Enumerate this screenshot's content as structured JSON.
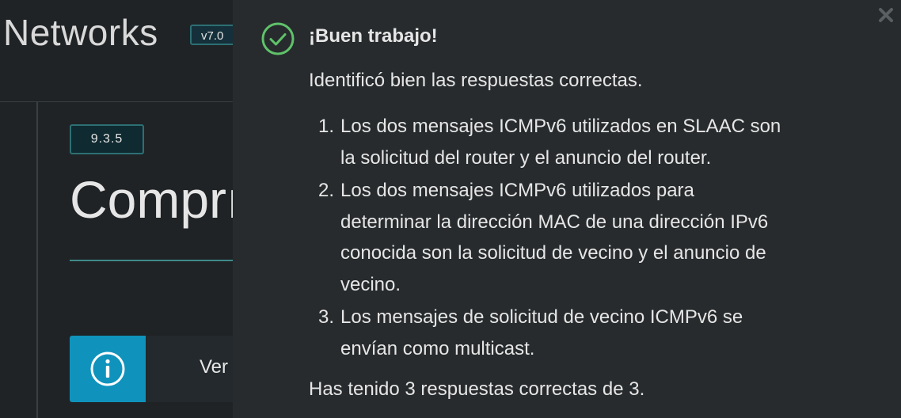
{
  "background": {
    "brand": "Networks",
    "version": "v7.0",
    "section_number": "9.3.5",
    "heading": "Comprı",
    "callout_text": "Ver"
  },
  "feedback": {
    "title": "¡Buen trabajo!",
    "intro": "Identificó bien las respuestas correctas.",
    "points": [
      {
        "number": "1.",
        "lines": [
          "Los dos mensajes ICMPv6 utilizados en SLAAC son",
          "la solicitud del router y el anuncio del router."
        ]
      },
      {
        "number": "2.",
        "lines": [
          "Los dos mensajes ICMPv6 utilizados para",
          "determinar la dirección MAC de una dirección IPv6",
          "conocida son la solicitud de vecino y el anuncio de",
          "vecino."
        ]
      },
      {
        "number": "3.",
        "lines": [
          "Los mensajes de solicitud de vecino ICMPv6 se",
          "envían como multicast."
        ]
      }
    ],
    "score": "Has tenido 3 respuestas correctas de 3."
  },
  "icons": {
    "success": "check-circle-icon",
    "close": "close-icon",
    "info": "info-icon"
  },
  "colors": {
    "success": "#5fc26a",
    "accent": "#0f93bd",
    "panel_bg": "#272b2d",
    "page_bg": "#1f2325"
  }
}
